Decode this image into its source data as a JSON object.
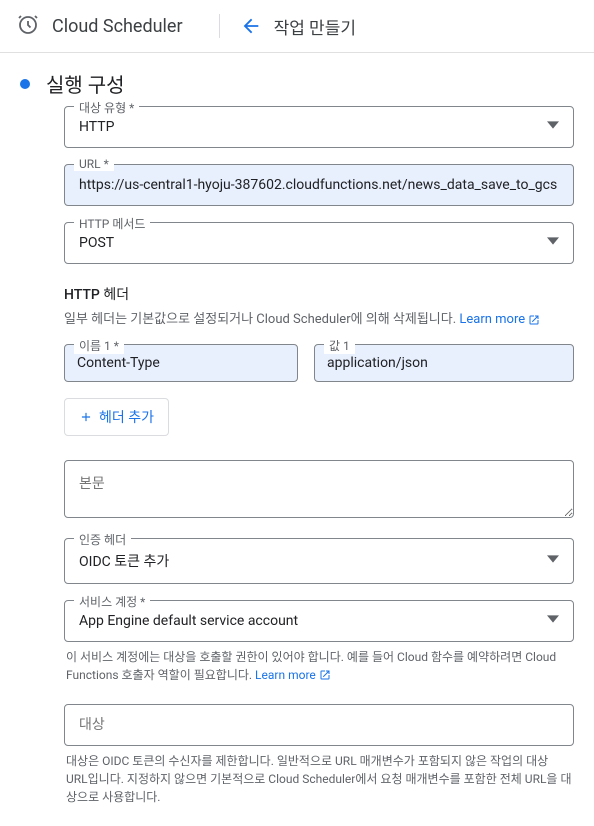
{
  "header": {
    "product_name": "Cloud Scheduler",
    "page_title": "작업 만들기"
  },
  "section": {
    "title": "실행 구성"
  },
  "target_type": {
    "label": "대상 유형 *",
    "value": "HTTP"
  },
  "url": {
    "label": "URL *",
    "value": "https://us-central1-hyoju-387602.cloudfunctions.net/news_data_save_to_gcs"
  },
  "http_method": {
    "label": "HTTP 메서드",
    "value": "POST"
  },
  "http_headers": {
    "title": "HTTP 헤더",
    "helper": "일부 헤더는 기본값으로 설정되거나 Cloud Scheduler에 의해 삭제됩니다. ",
    "learn_more": "Learn more",
    "name_label": "이름 1 *",
    "name_value": "Content-Type",
    "value_label": "값 1",
    "value_value": "application/json",
    "add_button": "헤더 추가"
  },
  "body": {
    "placeholder": "본문"
  },
  "auth_header": {
    "label": "인증 헤더",
    "value": "OIDC 토큰 추가"
  },
  "service_account": {
    "label": "서비스 계정 *",
    "value": "App Engine default service account",
    "hint": "이 서비스 계정에는 대상을 호출할 권한이 있어야 합니다. 예를 들어 Cloud 함수를 예약하려면 Cloud Functions 호출자 역할이 필요합니다. ",
    "learn_more": "Learn more"
  },
  "audience": {
    "placeholder": "대상",
    "hint": "대상은 OIDC 토큰의 수신자를 제한합니다. 일반적으로 URL 매개변수가 포함되지 않은 작업의 대상 URL입니다. 지정하지 않으면 기본적으로 Cloud Scheduler에서 요청 매개변수를 포함한 전체 URL을 대상으로 사용합니다."
  }
}
